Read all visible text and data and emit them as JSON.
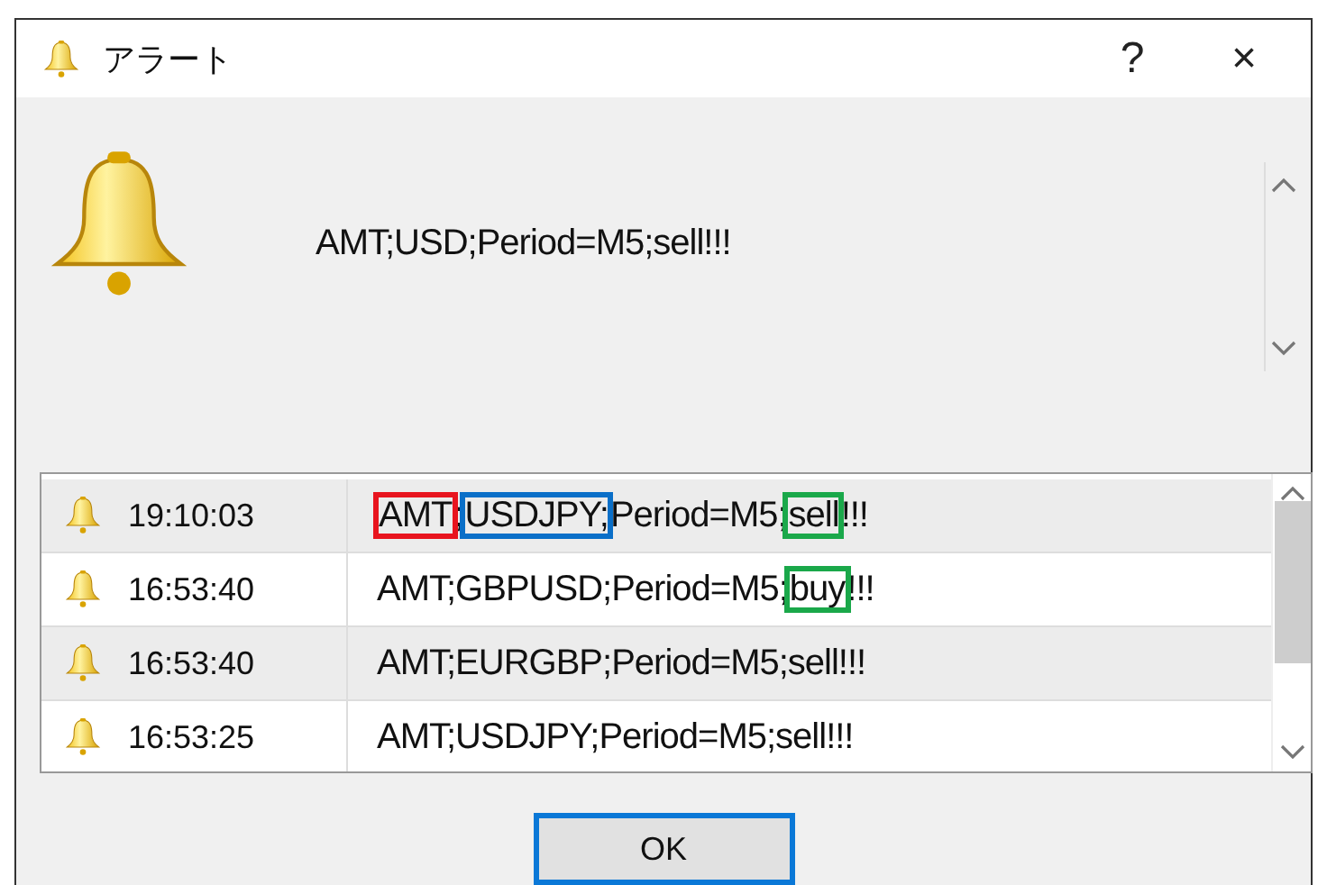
{
  "window": {
    "title": "アラート",
    "help": "?",
    "close": "×"
  },
  "message": "AMT;USD;Period=M5;sell!!!",
  "alerts": [
    {
      "time": "19:10:03",
      "segments": [
        {
          "text": "AMT",
          "color": "#e8141e"
        },
        {
          "text": ";"
        },
        {
          "text": "USDJPY;",
          "color": "#0a6fc8"
        },
        {
          "text": "Period=M5;"
        },
        {
          "text": "sell",
          "color": "#1aa84a"
        },
        {
          "text": "!!!"
        }
      ]
    },
    {
      "time": "16:53:40",
      "segments": [
        {
          "text": "AMT;GBPUSD;Period=M5;"
        },
        {
          "text": "buy",
          "color": "#1aa84a"
        },
        {
          "text": "!!!"
        }
      ]
    },
    {
      "time": "16:53:40",
      "segments": [
        {
          "text": "AMT;EURGBP;Period=M5;sell!!!"
        }
      ]
    },
    {
      "time": "16:53:25",
      "segments": [
        {
          "text": "AMT;USDJPY;Period=M5;sell!!!"
        }
      ]
    }
  ],
  "ok_button": "OK"
}
